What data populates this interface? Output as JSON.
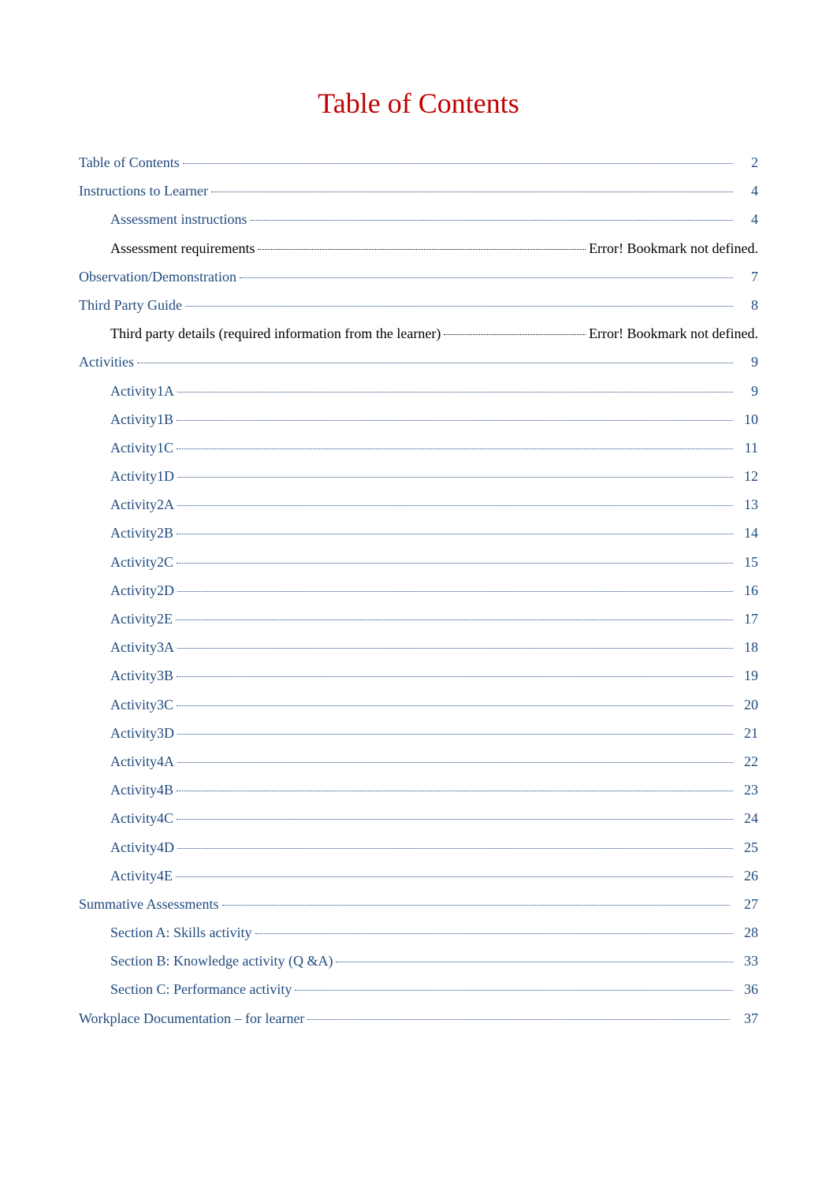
{
  "title": "Table of Contents",
  "entries": [
    {
      "label": "Table of Contents",
      "page": "2",
      "indent": 0,
      "link": true,
      "rightText": null
    },
    {
      "label": "Instructions  to Learner",
      "page": "4",
      "indent": 0,
      "link": true,
      "rightText": null
    },
    {
      "label": "Assessment instructions",
      "page": "4",
      "indent": 1,
      "link": true,
      "rightText": null
    },
    {
      "label": "Assessment requirements",
      "page": null,
      "indent": 1,
      "link": false,
      "rightText": "Error! Bookmark not defined."
    },
    {
      "label": "Observation/Demonstration",
      "page": "7",
      "indent": 0,
      "link": true,
      "rightText": null
    },
    {
      "label": "Third Party Guide",
      "page": "8",
      "indent": 0,
      "link": true,
      "rightText": null
    },
    {
      "label": "Third party details (required information from the learner)",
      "page": null,
      "indent": 1,
      "link": false,
      "rightText": "Error! Bookmark not defined."
    },
    {
      "label": "Activities",
      "page": "9",
      "indent": 0,
      "link": true,
      "rightText": null
    },
    {
      "label": "Activity1A",
      "page": "9",
      "indent": 1,
      "link": true,
      "rightText": null
    },
    {
      "label": "Activity1B",
      "page": "10",
      "indent": 1,
      "link": true,
      "rightText": null
    },
    {
      "label": "Activity1C",
      "page": "11",
      "indent": 1,
      "link": true,
      "rightText": null
    },
    {
      "label": "Activity1D",
      "page": "12",
      "indent": 1,
      "link": true,
      "rightText": null
    },
    {
      "label": "Activity2A",
      "page": "13",
      "indent": 1,
      "link": true,
      "rightText": null
    },
    {
      "label": "Activity2B",
      "page": "14",
      "indent": 1,
      "link": true,
      "rightText": null
    },
    {
      "label": "Activity2C",
      "page": "15",
      "indent": 1,
      "link": true,
      "rightText": null
    },
    {
      "label": "Activity2D",
      "page": "16",
      "indent": 1,
      "link": true,
      "rightText": null
    },
    {
      "label": "Activity2E",
      "page": "17",
      "indent": 1,
      "link": true,
      "rightText": null
    },
    {
      "label": "Activity3A",
      "page": "18",
      "indent": 1,
      "link": true,
      "rightText": null
    },
    {
      "label": "Activity3B",
      "page": "19",
      "indent": 1,
      "link": true,
      "rightText": null
    },
    {
      "label": "Activity3C",
      "page": "20",
      "indent": 1,
      "link": true,
      "rightText": null
    },
    {
      "label": "Activity3D",
      "page": "21",
      "indent": 1,
      "link": true,
      "rightText": null
    },
    {
      "label": "Activity4A",
      "page": "22",
      "indent": 1,
      "link": true,
      "rightText": null
    },
    {
      "label": "Activity4B",
      "page": "23",
      "indent": 1,
      "link": true,
      "rightText": null
    },
    {
      "label": "Activity4C",
      "page": "24",
      "indent": 1,
      "link": true,
      "rightText": null
    },
    {
      "label": "Activity4D",
      "page": "25",
      "indent": 1,
      "link": true,
      "rightText": null
    },
    {
      "label": "Activity4E",
      "page": "26",
      "indent": 1,
      "link": true,
      "rightText": null
    },
    {
      "label": "Summative Assessments",
      "page": "27",
      "indent": 0,
      "link": true,
      "rightText": null
    },
    {
      "label": "Section A: Skills activity",
      "page": "28",
      "indent": 1,
      "link": true,
      "rightText": null
    },
    {
      "label": "Section B: Knowledge activity (Q &A)",
      "page": "33",
      "indent": 1,
      "link": true,
      "rightText": null
    },
    {
      "label": "Section C: Performance activity",
      "page": "36",
      "indent": 1,
      "link": true,
      "rightText": null
    },
    {
      "label": "Workplace Documentation  – for learner",
      "page": "37",
      "indent": 0,
      "link": true,
      "rightText": null
    }
  ]
}
